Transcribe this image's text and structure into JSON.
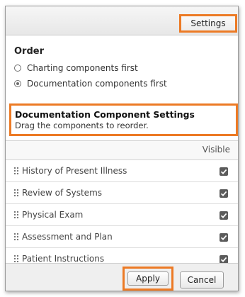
{
  "header": {
    "settings_label": "Settings"
  },
  "order": {
    "title": "Order",
    "options": [
      {
        "label": "Charting components first",
        "selected": false
      },
      {
        "label": "Documentation components first",
        "selected": true
      }
    ]
  },
  "doc_settings": {
    "title": "Documentation Component Settings",
    "subtitle": "Drag the components to reorder."
  },
  "table": {
    "visible_header": "Visible",
    "rows": [
      {
        "label": "History of Present Illness",
        "visible": true
      },
      {
        "label": "Review of Systems",
        "visible": true
      },
      {
        "label": "Physical Exam",
        "visible": true
      },
      {
        "label": "Assessment and Plan",
        "visible": true
      },
      {
        "label": "Patient Instructions",
        "visible": true
      }
    ]
  },
  "footer": {
    "apply_label": "Apply",
    "cancel_label": "Cancel"
  },
  "colors": {
    "highlight": "#ec7a25",
    "checkbox": "#5b5b5b"
  },
  "icons": {
    "drag": "drag-handle-icon",
    "check": "checkbox-checked-icon"
  }
}
